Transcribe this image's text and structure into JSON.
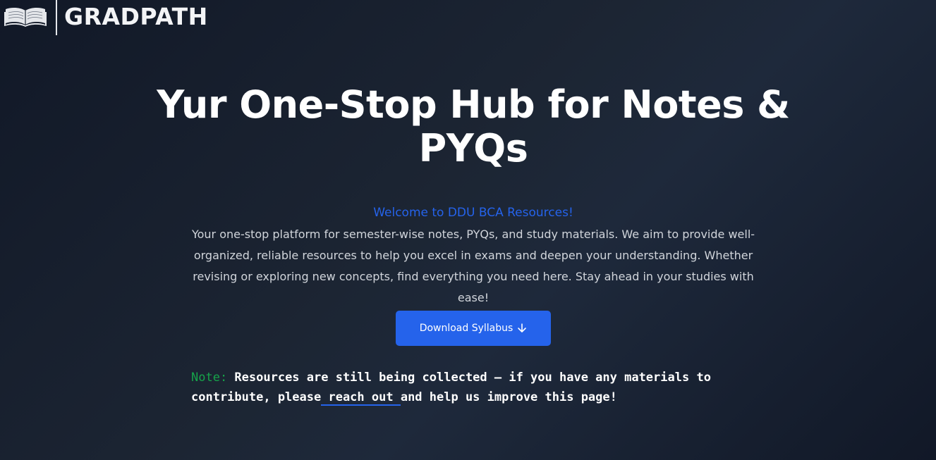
{
  "brand": {
    "logo_icon": "open-book-icon",
    "name": "GRADPATH"
  },
  "hero": {
    "title": "Yur One-Stop Hub for Notes & PYQs"
  },
  "intro": {
    "welcome": "Welcome to DDU BCA Resources!",
    "description": "Your one-stop platform for semester-wise notes, PYQs, and study materials. We aim to provide well-organized, reliable resources to help you excel in exams and deepen your understanding. Whether revising or exploring new concepts, find everything you need here. Stay ahead in your studies with ease!"
  },
  "cta": {
    "download_label": "Download Syllabus",
    "download_icon": "arrow-down-icon"
  },
  "note": {
    "label": "Note:",
    "text_before": " Resources are still being collected — if you have any materials to contribute, please",
    "link_text": " reach out ",
    "text_after": "and help us improve this page!"
  },
  "colors": {
    "accent": "#2563eb",
    "note_label": "#16a34a",
    "background": "#1e293b"
  }
}
